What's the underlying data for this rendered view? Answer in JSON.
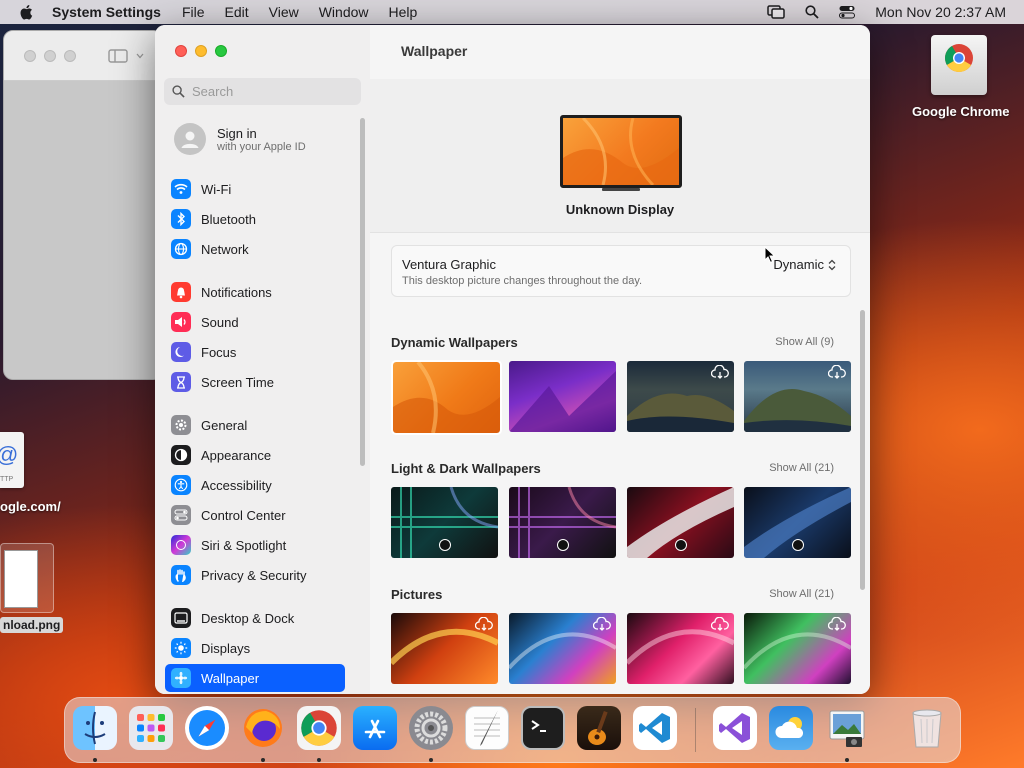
{
  "menubar": {
    "app": "System Settings",
    "items": [
      "File",
      "Edit",
      "View",
      "Window",
      "Help"
    ],
    "datetime": "Mon Nov 20  2:37 AM"
  },
  "desktop": {
    "chrome_label": "Google Chrome",
    "url_label": "ogle.com/",
    "png_label": "nload.png",
    "ttp": "TTP"
  },
  "sidebar": {
    "search_placeholder": "Search",
    "signin_title": "Sign in",
    "signin_sub": "with your Apple ID",
    "items": [
      {
        "label": "Wi-Fi",
        "color": "#0a84ff"
      },
      {
        "label": "Bluetooth",
        "color": "#0a84ff"
      },
      {
        "label": "Network",
        "color": "#0a84ff"
      },
      {
        "label": "Notifications",
        "color": "#ff3b30"
      },
      {
        "label": "Sound",
        "color": "#ff2d55"
      },
      {
        "label": "Focus",
        "color": "#5e5ce6"
      },
      {
        "label": "Screen Time",
        "color": "#5e5ce6"
      },
      {
        "label": "General",
        "color": "#8e8e93"
      },
      {
        "label": "Appearance",
        "color": "#1c1c1e"
      },
      {
        "label": "Accessibility",
        "color": "#0a84ff"
      },
      {
        "label": "Control Center",
        "color": "#8e8e93"
      },
      {
        "label": "Siri & Spotlight",
        "color": "#bf5af2"
      },
      {
        "label": "Privacy & Security",
        "color": "#0a84ff"
      },
      {
        "label": "Desktop & Dock",
        "color": "#1c1c1e"
      },
      {
        "label": "Displays",
        "color": "#0a84ff"
      },
      {
        "label": "Wallpaper",
        "color": "#30b0ff"
      }
    ]
  },
  "main": {
    "title": "Wallpaper",
    "display_name": "Unknown Display",
    "current": {
      "name": "Ventura Graphic",
      "desc": "This desktop picture changes throughout the day.",
      "mode": "Dynamic"
    },
    "sections": [
      {
        "title": "Dynamic Wallpapers",
        "show_all": "Show All (9)"
      },
      {
        "title": "Light & Dark Wallpapers",
        "show_all": "Show All (21)"
      },
      {
        "title": "Pictures",
        "show_all": "Show All (21)"
      }
    ]
  },
  "dock": {
    "apps": [
      "Finder",
      "Launchpad",
      "Safari",
      "Firefox",
      "Google Chrome",
      "App Store",
      "System Settings",
      "TextEdit",
      "Terminal",
      "GarageBand",
      "Visual Studio Code",
      "Visual Studio",
      "Weather",
      "Preview",
      "Trash"
    ]
  }
}
